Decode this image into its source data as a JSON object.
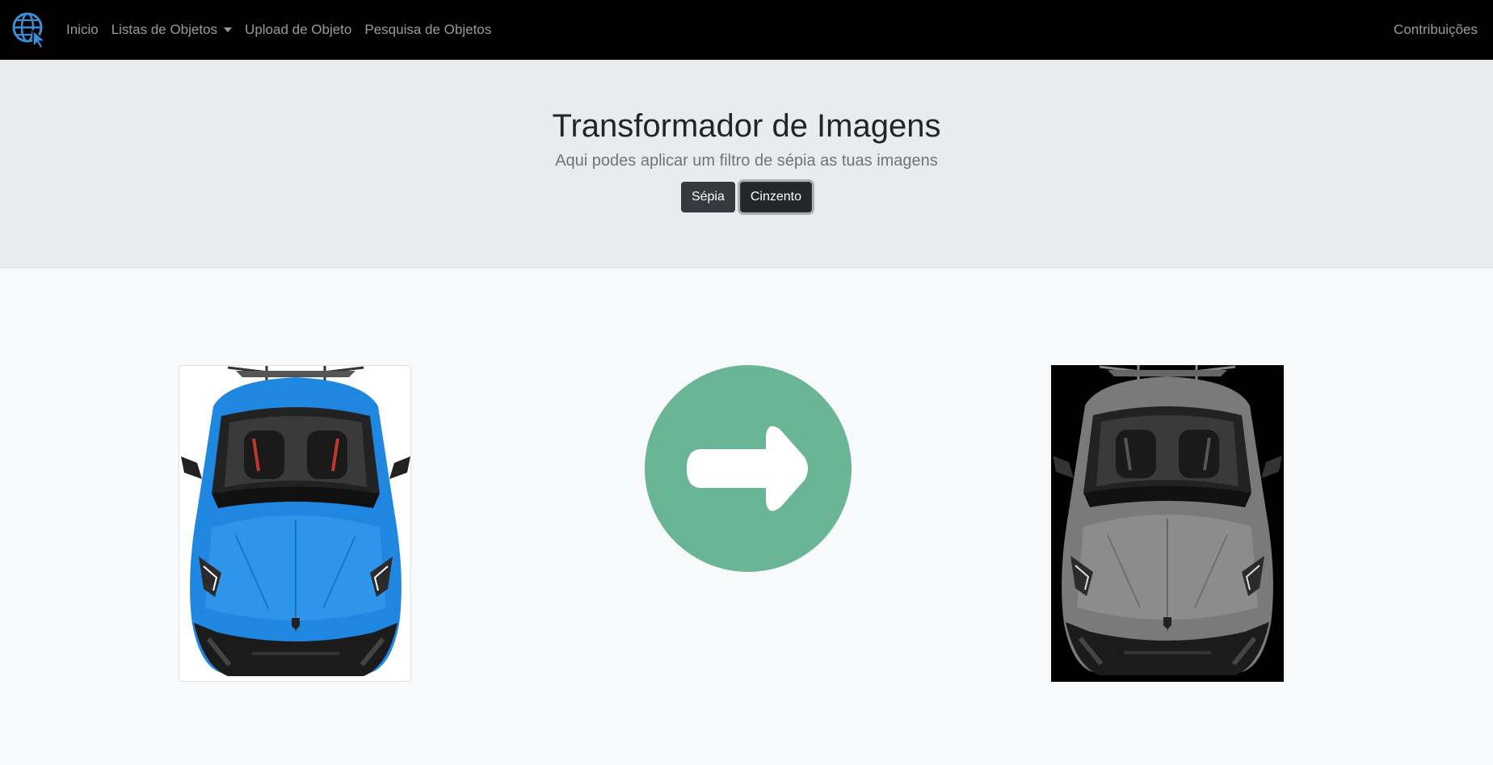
{
  "navbar": {
    "brand_icon": "globe-cursor-icon",
    "items": [
      {
        "label": "Inicio"
      },
      {
        "label": "Listas de Objetos",
        "dropdown": true
      },
      {
        "label": "Upload de Objeto"
      },
      {
        "label": "Pesquisa de Objetos"
      }
    ],
    "right_item": "Contribuições"
  },
  "hero": {
    "title": "Transformador de Imagens",
    "subtitle": "Aqui podes aplicar um filtro de sépia as tuas imagens",
    "buttons": [
      {
        "label": "Sépia",
        "active": false
      },
      {
        "label": "Cinzento",
        "active": true
      }
    ]
  },
  "images": {
    "original_icon": "blue-sports-car-image",
    "transform_icon": "arrow-right-circle-icon",
    "result_icon": "grayscale-sports-car-image"
  },
  "colors": {
    "navbar_bg": "#000000",
    "hero_bg": "#e9ecef",
    "arrow_green": "#69b595",
    "car_blue": "#1f87e0",
    "button_dark": "#343a40"
  }
}
